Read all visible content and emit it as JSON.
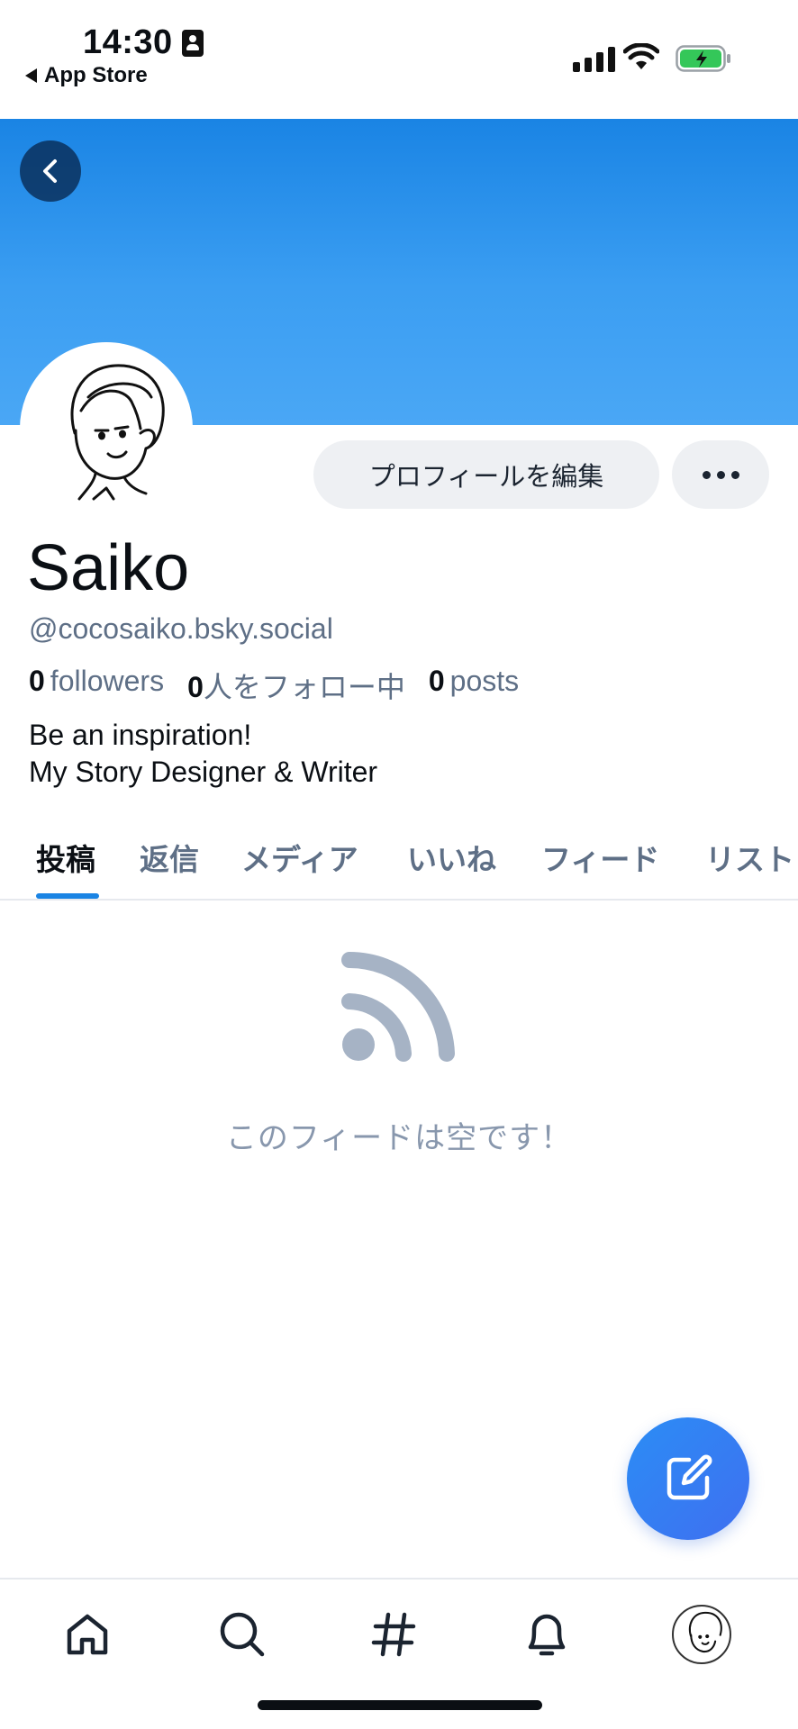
{
  "status_bar": {
    "time": "14:30",
    "back_app_label": "App Store"
  },
  "banner": {
    "color_top": "#1a84e4",
    "color_bottom": "#4aa7f5"
  },
  "profile": {
    "edit_button_label": "プロフィールを編集",
    "display_name": "Saiko",
    "handle": "@cocosaiko.bsky.social",
    "stats": {
      "followers_count": "0",
      "followers_label": "followers",
      "following_count": "0",
      "following_label": "人をフォロー中",
      "posts_count": "0",
      "posts_label": "posts"
    },
    "bio_line1": "Be an inspiration!",
    "bio_line2": "My Story Designer & Writer"
  },
  "tabs": [
    {
      "label": "投稿",
      "active": true
    },
    {
      "label": "返信",
      "active": false
    },
    {
      "label": "メディア",
      "active": false
    },
    {
      "label": "いいね",
      "active": false
    },
    {
      "label": "フィード",
      "active": false
    },
    {
      "label": "リスト",
      "active": false
    }
  ],
  "empty_state": {
    "icon": "rss-feed-icon",
    "text": "このフィードは空です！"
  },
  "accent_color": "#1a84e4",
  "bottom_nav": {
    "items": [
      "home-icon",
      "search-icon",
      "hashtag-icon",
      "bell-icon",
      "profile-avatar"
    ]
  }
}
